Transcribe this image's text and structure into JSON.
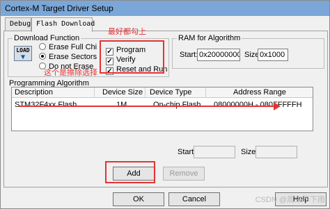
{
  "window": {
    "title": "Cortex-M Target Driver Setup"
  },
  "tabs": [
    {
      "label": "Debug",
      "active": false
    },
    {
      "label": "Flash Download",
      "active": true
    }
  ],
  "download_function": {
    "label": "Download Function",
    "icon_text": "LOAD",
    "options": [
      {
        "label": "Erase Full Chi",
        "selected": false
      },
      {
        "label": "Erase Sectors",
        "selected": true
      },
      {
        "label": "Do not Erase",
        "selected": false
      }
    ],
    "checks": [
      {
        "label": "Program",
        "checked": true
      },
      {
        "label": "Verify",
        "checked": true
      },
      {
        "label": "Reset and Run",
        "checked": true
      }
    ]
  },
  "ram": {
    "label": "RAM for Algorithm",
    "start_label": "Start:",
    "start_value": "0x20000000",
    "size_label": "Size:",
    "size_value": "0x1000"
  },
  "programming_algorithm": {
    "label": "Programming Algorithm",
    "columns": [
      "Description",
      "Device Size",
      "Device Type",
      "Address Range"
    ],
    "rows": [
      {
        "description": "STM32F4xx Flash",
        "size": "1M",
        "type": "On-chip Flash",
        "range": "08000000H - 080FFFFFH"
      }
    ],
    "start_label": "Start:",
    "size_label": "Size:"
  },
  "buttons": {
    "add": "Add",
    "remove": "Remove",
    "ok": "OK",
    "cancel": "Cancel",
    "help": "Help"
  },
  "annotations": {
    "check_all": "最好都勾上",
    "erase_choice": "这个是擦除选择"
  },
  "watermark": "CSDN @周末不下雨",
  "colors": {
    "annotation": "#e53232",
    "titlebar": "#7aa7d8"
  }
}
